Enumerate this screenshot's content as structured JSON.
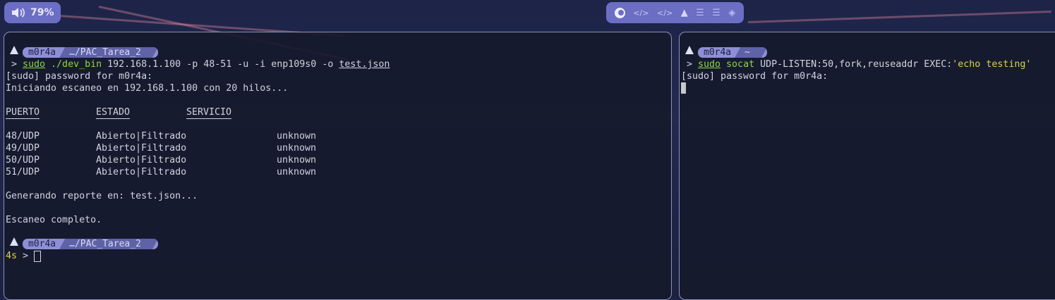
{
  "volume": {
    "icon": "speaker-icon",
    "level": "79%"
  },
  "workspaces": {
    "icons": [
      "firefox-icon",
      "code-icon",
      "code-icon",
      "arch-icon",
      "list-icon",
      "list-icon",
      "stack-icon"
    ]
  },
  "left": {
    "prompt1": {
      "user": "m0r4a",
      "path": "…/PAC_Tarea_2"
    },
    "cmd": {
      "sudo": "sudo",
      "bin": "./dev_bin",
      "args": " 192.168.1.100 -p 48-51 -u -i enp109s0 -o ",
      "file": "test.json"
    },
    "lines": {
      "sudo_pw": "[sudo] password for m0r4a:",
      "scan_start": "Iniciando escaneo en 192.168.1.100 con 20 hilos...",
      "report": "Generando reporte en: test.json...",
      "done": "Escaneo completo."
    },
    "table": {
      "headers": [
        "PUERTO",
        "ESTADO",
        "SERVICIO"
      ],
      "rows": [
        [
          "48/UDP",
          "Abierto|Filtrado",
          "unknown"
        ],
        [
          "49/UDP",
          "Abierto|Filtrado",
          "unknown"
        ],
        [
          "50/UDP",
          "Abierto|Filtrado",
          "unknown"
        ],
        [
          "51/UDP",
          "Abierto|Filtrado",
          "unknown"
        ]
      ]
    },
    "prompt2": {
      "user": "m0r4a",
      "path": "…/PAC_Tarea_2",
      "duration": "4s"
    }
  },
  "right": {
    "prompt1": {
      "user": "m0r4a",
      "path": "~"
    },
    "cmd": {
      "sudo": "sudo",
      "bin": "socat",
      "args": " UDP-LISTEN:50,fork,reuseaddr EXEC:",
      "quoted": "'echo testing'"
    },
    "sudo_pw": "[sudo] password for m0r4a:"
  },
  "prompt_symbol": ">"
}
